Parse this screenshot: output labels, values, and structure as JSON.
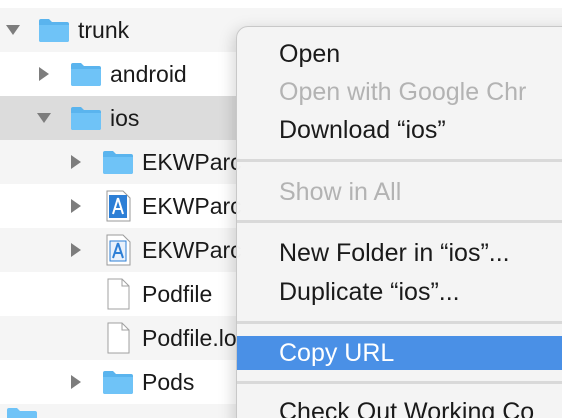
{
  "colors": {
    "folder_fill": "#6fc3f7",
    "folder_tab": "#5ab4ee",
    "selection": "#dcdcdc",
    "menu_highlight": "#4a90e6",
    "disabled_text": "#b3b3b3"
  },
  "tree": {
    "rows": [
      {
        "label": "trunk",
        "icon": "folder-icon",
        "expanded": true
      },
      {
        "label": "android",
        "icon": "folder-icon",
        "expanded": false
      },
      {
        "label": "ios",
        "icon": "folder-icon",
        "expanded": true,
        "selected": true
      },
      {
        "label": "EKWParc",
        "icon": "folder-icon",
        "expanded": false
      },
      {
        "label": "EKWParc",
        "icon": "xcode-project-icon",
        "expanded": false
      },
      {
        "label": "EKWParc",
        "icon": "xcode-project-icon",
        "expanded": false
      },
      {
        "label": "Podfile",
        "icon": "document-icon"
      },
      {
        "label": "Podfile.lo",
        "icon": "document-icon"
      },
      {
        "label": "Pods",
        "icon": "folder-icon",
        "expanded": false
      }
    ]
  },
  "context_menu": {
    "items": [
      {
        "label": "Open",
        "enabled": true
      },
      {
        "label": "Open with Google Chr",
        "enabled": false
      },
      {
        "label": "Download “ios”",
        "enabled": true
      },
      {
        "label": "Show in All",
        "enabled": false
      },
      {
        "label": "New Folder in “ios”...",
        "enabled": true
      },
      {
        "label": "Duplicate “ios”...",
        "enabled": true
      },
      {
        "label": "Copy URL",
        "enabled": true,
        "highlighted": true
      },
      {
        "label": "Check Out Working Co",
        "enabled": true
      }
    ]
  }
}
